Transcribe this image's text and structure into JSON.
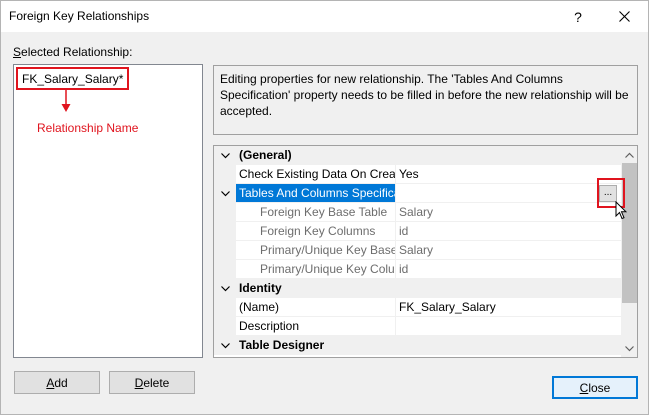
{
  "window": {
    "title": "Foreign Key Relationships",
    "help_label": "?",
    "close_icon": "close-icon"
  },
  "left_panel": {
    "label_accel": "S",
    "label_rest": "elected Relationship:",
    "items": [
      {
        "label": "FK_Salary_Salary*",
        "selected": true
      }
    ],
    "annotation": "Relationship Name",
    "annotation_color": "#e0141e"
  },
  "info": {
    "text": "Editing properties for new relationship.  The 'Tables And Columns Specification' property needs to be filled in before the new relationship will be accepted."
  },
  "grid": {
    "rows": [
      {
        "type": "category",
        "name": "(General)",
        "value": "",
        "expanded": true
      },
      {
        "type": "property",
        "name": "Check Existing Data On Creat",
        "value": "Yes"
      },
      {
        "type": "property-selected",
        "name": "Tables And Columns Specifica",
        "value": "",
        "expanded": true,
        "has_ellipsis": true
      },
      {
        "type": "sub",
        "name": "Foreign Key Base Table",
        "value": "Salary"
      },
      {
        "type": "sub",
        "name": "Foreign Key Columns",
        "value": "id"
      },
      {
        "type": "sub",
        "name": "Primary/Unique Key Base",
        "value": "Salary"
      },
      {
        "type": "sub",
        "name": "Primary/Unique Key Colu",
        "value": "id"
      },
      {
        "type": "category",
        "name": "Identity",
        "value": "",
        "expanded": true
      },
      {
        "type": "property",
        "name": "(Name)",
        "value": "FK_Salary_Salary"
      },
      {
        "type": "property",
        "name": "Description",
        "value": ""
      },
      {
        "type": "category",
        "name": "Table Designer",
        "value": "",
        "expanded": true
      }
    ],
    "ellipsis_label": "...",
    "selection_color": "#0078d7"
  },
  "buttons": {
    "add_accel": "A",
    "add_rest": "dd",
    "delete_accel": "D",
    "delete_rest": "elete",
    "close_accel": "C",
    "close_rest": "lose"
  }
}
